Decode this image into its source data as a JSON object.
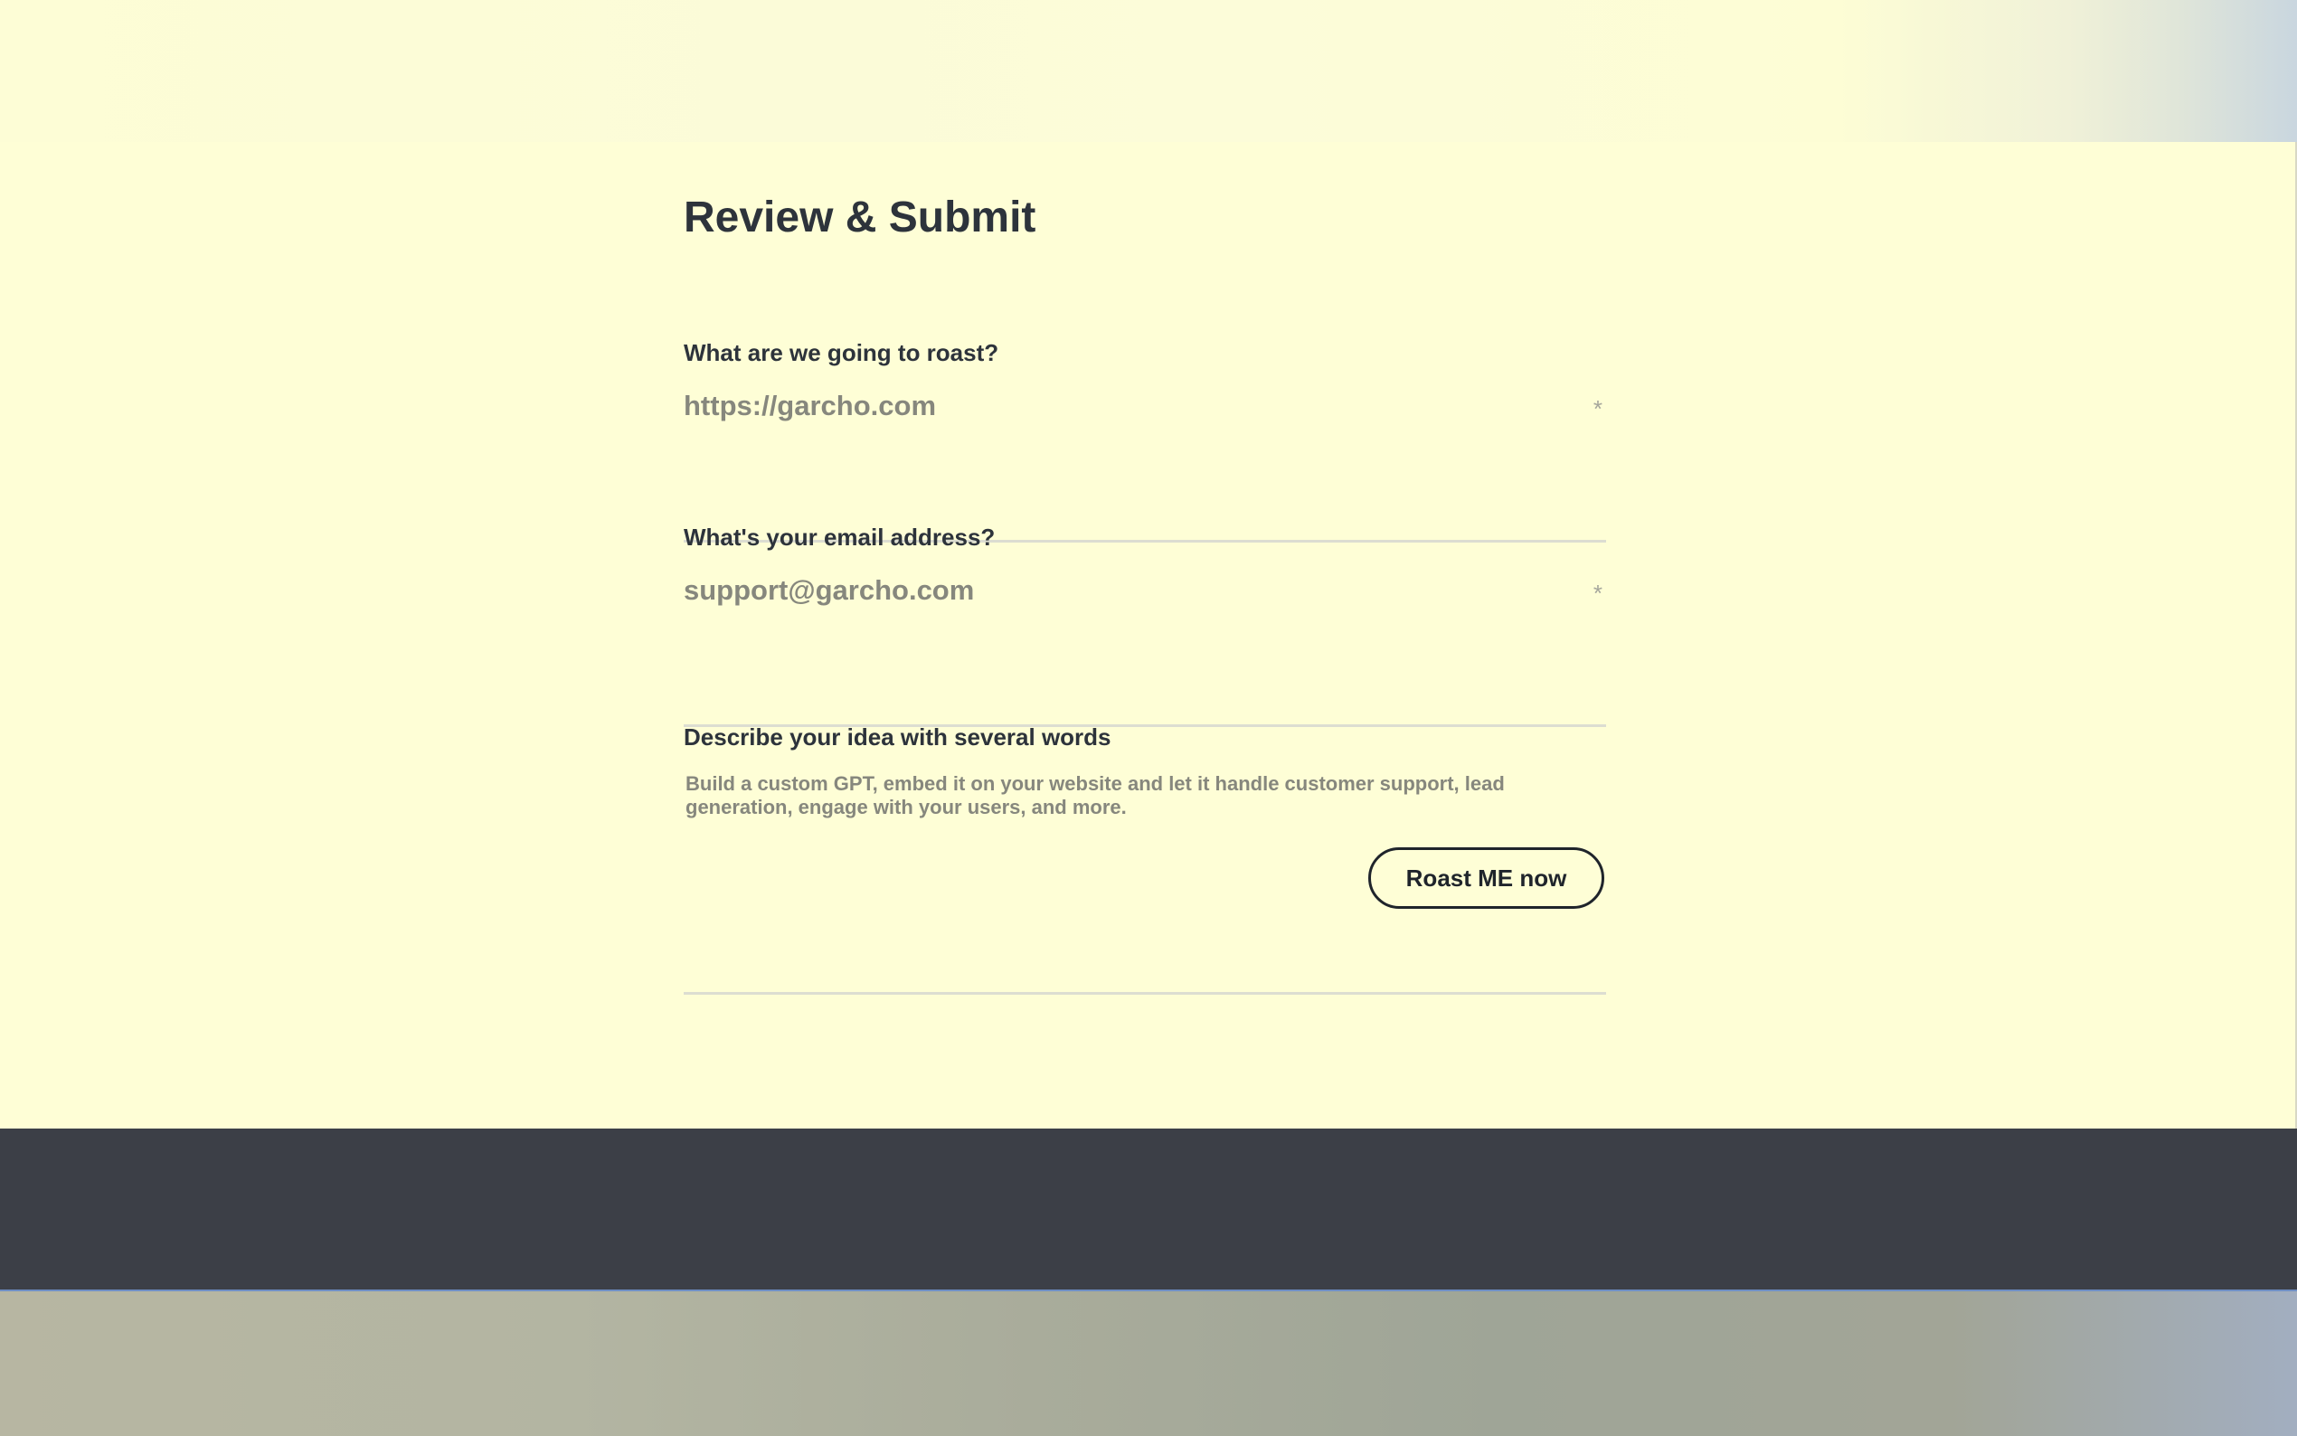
{
  "form": {
    "title": "Review & Submit",
    "url_field": {
      "label": "What are we going to roast?",
      "placeholder": "https://garcho.com",
      "value": "",
      "required_mark": "*"
    },
    "email_field": {
      "label": "What's your email address?",
      "placeholder": "support@garcho.com",
      "value": "",
      "required_mark": "*"
    },
    "idea_field": {
      "label": "Describe your idea with several words",
      "placeholder": "Build a custom GPT, embed it on your website and let it handle customer support, lead generation, engage with your users, and more.",
      "value": ""
    },
    "submit_label": "Roast ME now"
  },
  "colors": {
    "background": "#fefed6",
    "text": "#2d333b",
    "placeholder": "#86877d",
    "footer": "#3c3f47"
  }
}
